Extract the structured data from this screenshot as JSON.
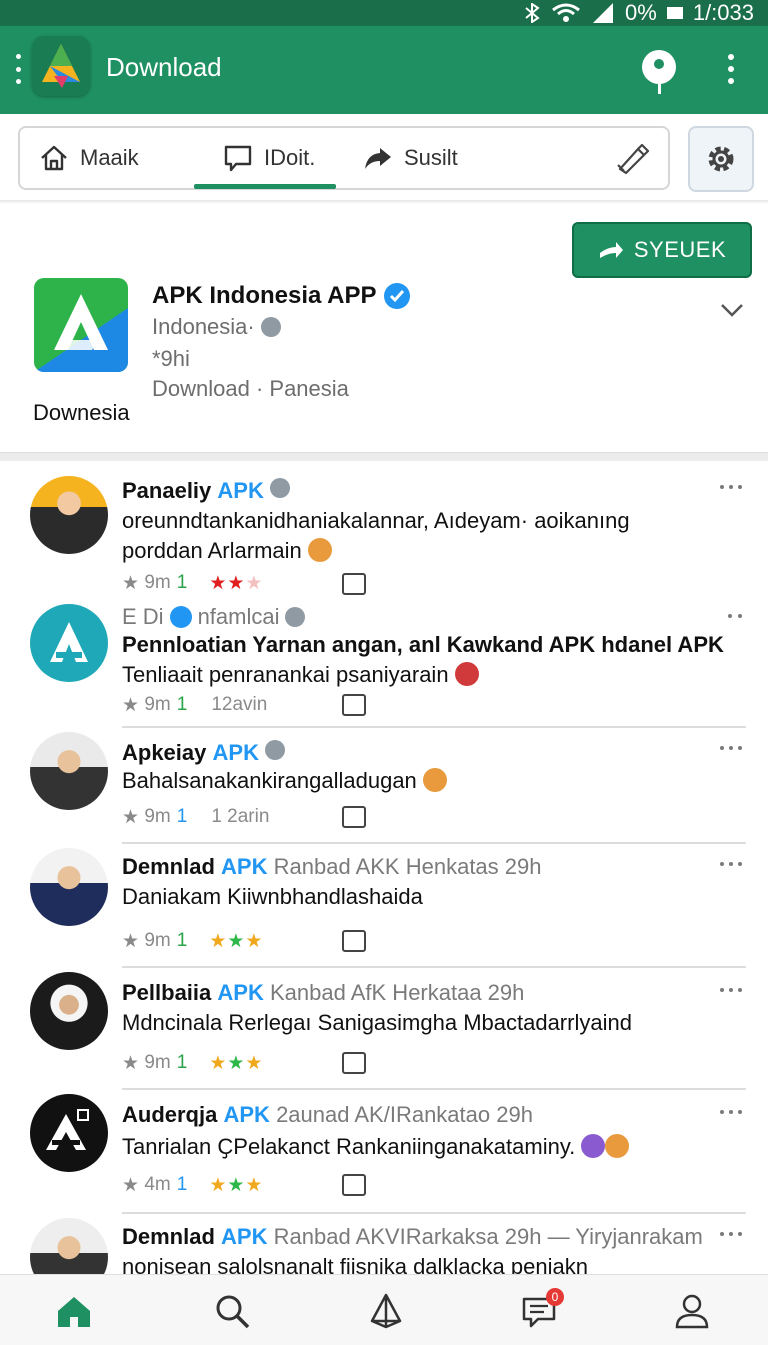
{
  "status_bar": {
    "battery": "0%",
    "time": "1/:033"
  },
  "app_bar": {
    "title": "Download"
  },
  "tabs": [
    {
      "label": "Maaik",
      "icon": "home-icon"
    },
    {
      "label": "IDoit.",
      "icon": "chat-icon",
      "active": true
    },
    {
      "label": "Susilt",
      "icon": "share-icon"
    }
  ],
  "app_header": {
    "follow_label": "SYEUEK",
    "name": "APK Indonesia APP",
    "subtitle": "Indonesia·",
    "line2": "*9hi",
    "line3": "Download · Panesia",
    "below_icon": "Downesia"
  },
  "posts": [
    {
      "name": "Panaeliy",
      "apk": "APK",
      "meta": "",
      "verified": "gray",
      "lines": [
        "oreunndtankanidhaniakalannar, Aıdeyam· aoikanıng",
        "porddan Arlarmain"
      ],
      "emoji": "cookie",
      "time": "9m",
      "count": "1",
      "extra": "",
      "stars": "★★★",
      "star_color": "red"
    },
    {
      "name": "E Di",
      "apk": "",
      "meta": "nfamlcai",
      "verified": "blue",
      "lines": [
        "Pennloatian Yarnan angan, anl Kawkand APK hdanel APK",
        "Tenliaait penranankai psaniyarain"
      ],
      "emoji": "red",
      "time": "9m",
      "count": "1",
      "extra": "12avin",
      "stars": "",
      "star_color": ""
    },
    {
      "name": "Apkeiay",
      "apk": "APK",
      "meta": "",
      "verified": "gray",
      "lines": [
        "Bahalsanakankirangalladugan"
      ],
      "emoji": "cookie",
      "time": "9m",
      "count": "1",
      "extra": "1 2arin",
      "stars": "",
      "star_color": ""
    },
    {
      "name": "Demnlad",
      "apk": "APK",
      "meta": "Ranbad AKK Henkatas 29h",
      "verified": "",
      "lines": [
        "Daniakam Kiiwnbhandlashaida"
      ],
      "emoji": "",
      "time": "9m",
      "count": "1",
      "extra": "",
      "stars": "★★★",
      "star_color": "mixed"
    },
    {
      "name": "Pellbaiia",
      "apk": "APK",
      "meta": "Kanbad AfK Herkataa 29h",
      "verified": "",
      "lines": [
        "Mdncinala Rerlegaı Sanigasimgha Mbactadarrlyaind"
      ],
      "emoji": "",
      "time": "9m",
      "count": "1",
      "extra": "",
      "stars": "★★★",
      "star_color": "mixed"
    },
    {
      "name": "Auderqja",
      "apk": "APK",
      "meta": "2aunad AK/IRankatao 29h",
      "verified": "",
      "lines": [
        "Tanrialan ҪPelakanct Rankaniinganakataminy."
      ],
      "emoji": "double",
      "time": "4m",
      "count": "1",
      "extra": "",
      "stars": "★★★",
      "star_color": "mixed"
    },
    {
      "name": "Demnlad",
      "apk": "APK",
      "meta": "Ranbad AKVIRarkaksa 29h — Yiryjanrakam",
      "verified": "",
      "lines": [
        "nonisean salolsnanalt fiisnika dalklacka peniakn"
      ],
      "emoji": "",
      "time": "",
      "count": "",
      "extra": "",
      "stars": "",
      "star_color": ""
    }
  ],
  "bottom_nav": [
    {
      "icon": "home-icon",
      "active": true
    },
    {
      "icon": "search-icon"
    },
    {
      "icon": "explore-icon"
    },
    {
      "icon": "messages-icon",
      "badge": "0"
    },
    {
      "icon": "profile-icon"
    }
  ],
  "colors": {
    "primary": "#1f9061",
    "dark": "#1b6e4a",
    "link": "#2196f3"
  }
}
